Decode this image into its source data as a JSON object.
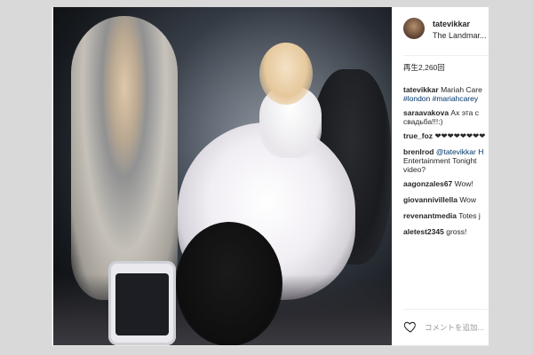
{
  "post": {
    "username": "tatevikkar",
    "location": "The Landmar...",
    "views": "再生2,260回",
    "caption": {
      "user": "tatevikkar",
      "text": "Mariah Care",
      "tags_line": "#london #mariahcarey"
    },
    "comments": [
      {
        "user": "saraavakova",
        "text": "Ах эта с",
        "text2": "свадьба!!!:)"
      },
      {
        "user": "true_foz",
        "text": "❤❤❤❤❤❤❤❤"
      },
      {
        "user": "brenlrod",
        "text": "@tatevikkar H",
        "text2": "Entertainment Tonight",
        "text3": "video?"
      },
      {
        "user": "aagonzales67",
        "text": "Wow!"
      },
      {
        "user": "giovannivillella",
        "text": "Wow"
      },
      {
        "user": "revenantmedia",
        "text": "Totes j"
      },
      {
        "user": "aletest2345",
        "text": "gross!"
      }
    ],
    "add_comment_placeholder": "コメントを追加..."
  },
  "icons": {
    "heart": "heart-icon",
    "avatar": "avatar"
  },
  "colors": {
    "link": "#003569",
    "text": "#262626",
    "muted": "#999999"
  }
}
